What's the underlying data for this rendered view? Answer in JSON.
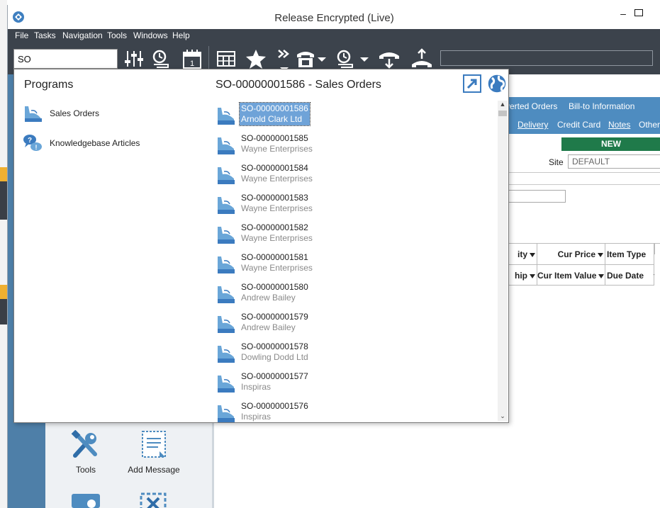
{
  "window": {
    "title": "Release Encrypted (Live)"
  },
  "menu": [
    "File",
    "Tasks",
    "Navigation",
    "Tools",
    "Windows",
    "Help"
  ],
  "toolbar": {
    "search_value": "SO",
    "icons": [
      "sliders-icon",
      "process-clock-icon",
      "calendar-icon",
      "grid-icon",
      "star-icon",
      "double-chevron-icon",
      "phone-book-icon",
      "process-dropdown-icon",
      "hang-up-icon",
      "call-out-icon"
    ]
  },
  "popup": {
    "programs_title": "Programs",
    "programs": [
      {
        "label": "Sales Orders",
        "icon": "sales-order-icon"
      },
      {
        "label": "Knowledgebase Articles",
        "icon": "knowledgebase-icon"
      }
    ],
    "results_title": "SO-00000001586 - Sales Orders",
    "results": [
      {
        "number": "SO-00000001586",
        "customer": "Arnold Clark Ltd",
        "selected": true
      },
      {
        "number": "SO-00000001585",
        "customer": "Wayne Enterprises"
      },
      {
        "number": "SO-00000001584",
        "customer": "Wayne Enterprises"
      },
      {
        "number": "SO-00000001583",
        "customer": "Wayne Enterprises"
      },
      {
        "number": "SO-00000001582",
        "customer": "Wayne Enterprises"
      },
      {
        "number": "SO-00000001581",
        "customer": "Wayne Enterprises"
      },
      {
        "number": "SO-00000001580",
        "customer": "Andrew Bailey"
      },
      {
        "number": "SO-00000001579",
        "customer": "Andrew Bailey"
      },
      {
        "number": "SO-00000001578",
        "customer": "Dowling Dodd Ltd"
      },
      {
        "number": "SO-00000001577",
        "customer": "Inspiras"
      },
      {
        "number": "SO-00000001576",
        "customer": "Inspiras"
      }
    ]
  },
  "side_tiles": [
    {
      "label": "Tools",
      "icon": "tools-icon"
    },
    {
      "label": "Add Message",
      "icon": "add-message-icon"
    }
  ],
  "background": {
    "tabs_row1": [
      "verted Orders",
      "Bill-to Information"
    ],
    "tabs_row2": [
      "Delivery",
      "Credit Card",
      "Notes",
      "Other"
    ],
    "new_badge": "NEW",
    "site_label": "Site",
    "site_value": "DEFAULT",
    "grid_row1": [
      "ity",
      "Cur Price",
      "Item Type"
    ],
    "grid_row2": [
      "hip",
      "Cur Item Value",
      "Due Date"
    ]
  },
  "colors": {
    "dark_toolbar": "#3c434c",
    "accent_blue": "#4e8cc0",
    "selection": "#6fa3d8",
    "new_green": "#1f7a4a"
  }
}
